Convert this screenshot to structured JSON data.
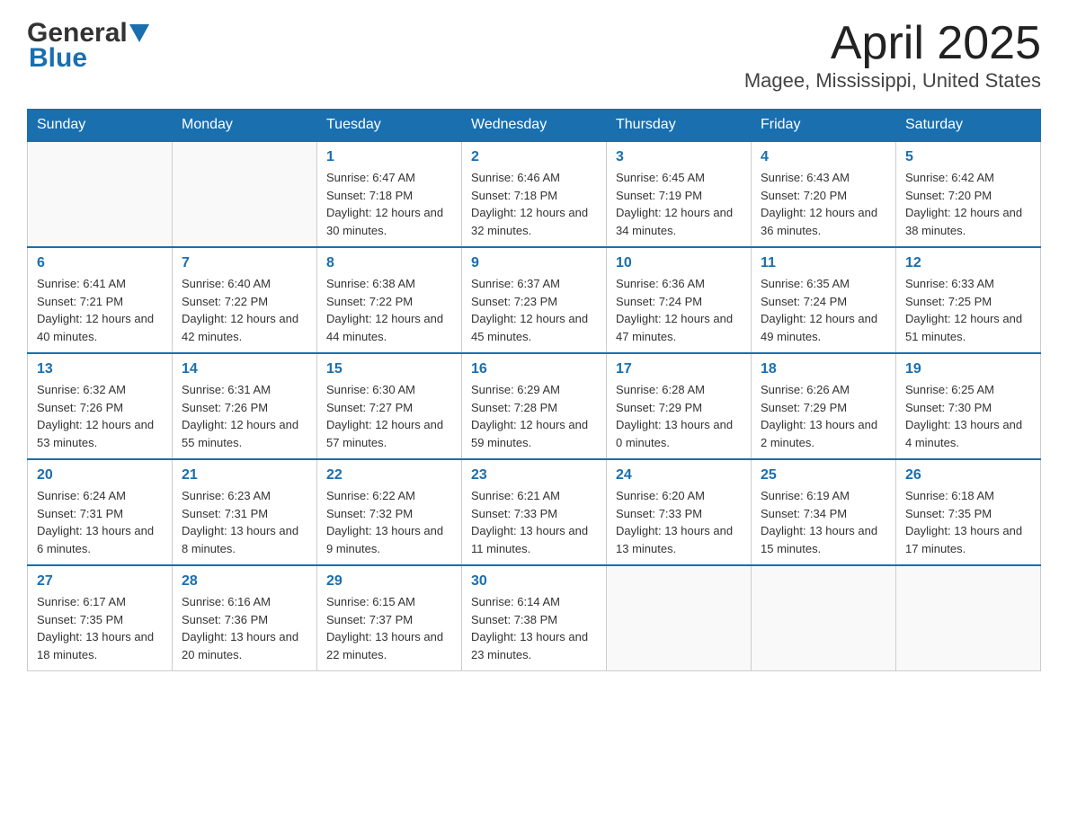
{
  "header": {
    "logo_main": "General",
    "logo_sub": "Blue",
    "title": "April 2025",
    "subtitle": "Magee, Mississippi, United States"
  },
  "days_of_week": [
    "Sunday",
    "Monday",
    "Tuesday",
    "Wednesday",
    "Thursday",
    "Friday",
    "Saturday"
  ],
  "weeks": [
    {
      "days": [
        {
          "number": "",
          "sunrise": "",
          "sunset": "",
          "daylight": "",
          "empty": true
        },
        {
          "number": "",
          "sunrise": "",
          "sunset": "",
          "daylight": "",
          "empty": true
        },
        {
          "number": "1",
          "sunrise": "Sunrise: 6:47 AM",
          "sunset": "Sunset: 7:18 PM",
          "daylight": "Daylight: 12 hours and 30 minutes."
        },
        {
          "number": "2",
          "sunrise": "Sunrise: 6:46 AM",
          "sunset": "Sunset: 7:18 PM",
          "daylight": "Daylight: 12 hours and 32 minutes."
        },
        {
          "number": "3",
          "sunrise": "Sunrise: 6:45 AM",
          "sunset": "Sunset: 7:19 PM",
          "daylight": "Daylight: 12 hours and 34 minutes."
        },
        {
          "number": "4",
          "sunrise": "Sunrise: 6:43 AM",
          "sunset": "Sunset: 7:20 PM",
          "daylight": "Daylight: 12 hours and 36 minutes."
        },
        {
          "number": "5",
          "sunrise": "Sunrise: 6:42 AM",
          "sunset": "Sunset: 7:20 PM",
          "daylight": "Daylight: 12 hours and 38 minutes."
        }
      ]
    },
    {
      "days": [
        {
          "number": "6",
          "sunrise": "Sunrise: 6:41 AM",
          "sunset": "Sunset: 7:21 PM",
          "daylight": "Daylight: 12 hours and 40 minutes."
        },
        {
          "number": "7",
          "sunrise": "Sunrise: 6:40 AM",
          "sunset": "Sunset: 7:22 PM",
          "daylight": "Daylight: 12 hours and 42 minutes."
        },
        {
          "number": "8",
          "sunrise": "Sunrise: 6:38 AM",
          "sunset": "Sunset: 7:22 PM",
          "daylight": "Daylight: 12 hours and 44 minutes."
        },
        {
          "number": "9",
          "sunrise": "Sunrise: 6:37 AM",
          "sunset": "Sunset: 7:23 PM",
          "daylight": "Daylight: 12 hours and 45 minutes."
        },
        {
          "number": "10",
          "sunrise": "Sunrise: 6:36 AM",
          "sunset": "Sunset: 7:24 PM",
          "daylight": "Daylight: 12 hours and 47 minutes."
        },
        {
          "number": "11",
          "sunrise": "Sunrise: 6:35 AM",
          "sunset": "Sunset: 7:24 PM",
          "daylight": "Daylight: 12 hours and 49 minutes."
        },
        {
          "number": "12",
          "sunrise": "Sunrise: 6:33 AM",
          "sunset": "Sunset: 7:25 PM",
          "daylight": "Daylight: 12 hours and 51 minutes."
        }
      ]
    },
    {
      "days": [
        {
          "number": "13",
          "sunrise": "Sunrise: 6:32 AM",
          "sunset": "Sunset: 7:26 PM",
          "daylight": "Daylight: 12 hours and 53 minutes."
        },
        {
          "number": "14",
          "sunrise": "Sunrise: 6:31 AM",
          "sunset": "Sunset: 7:26 PM",
          "daylight": "Daylight: 12 hours and 55 minutes."
        },
        {
          "number": "15",
          "sunrise": "Sunrise: 6:30 AM",
          "sunset": "Sunset: 7:27 PM",
          "daylight": "Daylight: 12 hours and 57 minutes."
        },
        {
          "number": "16",
          "sunrise": "Sunrise: 6:29 AM",
          "sunset": "Sunset: 7:28 PM",
          "daylight": "Daylight: 12 hours and 59 minutes."
        },
        {
          "number": "17",
          "sunrise": "Sunrise: 6:28 AM",
          "sunset": "Sunset: 7:29 PM",
          "daylight": "Daylight: 13 hours and 0 minutes."
        },
        {
          "number": "18",
          "sunrise": "Sunrise: 6:26 AM",
          "sunset": "Sunset: 7:29 PM",
          "daylight": "Daylight: 13 hours and 2 minutes."
        },
        {
          "number": "19",
          "sunrise": "Sunrise: 6:25 AM",
          "sunset": "Sunset: 7:30 PM",
          "daylight": "Daylight: 13 hours and 4 minutes."
        }
      ]
    },
    {
      "days": [
        {
          "number": "20",
          "sunrise": "Sunrise: 6:24 AM",
          "sunset": "Sunset: 7:31 PM",
          "daylight": "Daylight: 13 hours and 6 minutes."
        },
        {
          "number": "21",
          "sunrise": "Sunrise: 6:23 AM",
          "sunset": "Sunset: 7:31 PM",
          "daylight": "Daylight: 13 hours and 8 minutes."
        },
        {
          "number": "22",
          "sunrise": "Sunrise: 6:22 AM",
          "sunset": "Sunset: 7:32 PM",
          "daylight": "Daylight: 13 hours and 9 minutes."
        },
        {
          "number": "23",
          "sunrise": "Sunrise: 6:21 AM",
          "sunset": "Sunset: 7:33 PM",
          "daylight": "Daylight: 13 hours and 11 minutes."
        },
        {
          "number": "24",
          "sunrise": "Sunrise: 6:20 AM",
          "sunset": "Sunset: 7:33 PM",
          "daylight": "Daylight: 13 hours and 13 minutes."
        },
        {
          "number": "25",
          "sunrise": "Sunrise: 6:19 AM",
          "sunset": "Sunset: 7:34 PM",
          "daylight": "Daylight: 13 hours and 15 minutes."
        },
        {
          "number": "26",
          "sunrise": "Sunrise: 6:18 AM",
          "sunset": "Sunset: 7:35 PM",
          "daylight": "Daylight: 13 hours and 17 minutes."
        }
      ]
    },
    {
      "days": [
        {
          "number": "27",
          "sunrise": "Sunrise: 6:17 AM",
          "sunset": "Sunset: 7:35 PM",
          "daylight": "Daylight: 13 hours and 18 minutes."
        },
        {
          "number": "28",
          "sunrise": "Sunrise: 6:16 AM",
          "sunset": "Sunset: 7:36 PM",
          "daylight": "Daylight: 13 hours and 20 minutes."
        },
        {
          "number": "29",
          "sunrise": "Sunrise: 6:15 AM",
          "sunset": "Sunset: 7:37 PM",
          "daylight": "Daylight: 13 hours and 22 minutes."
        },
        {
          "number": "30",
          "sunrise": "Sunrise: 6:14 AM",
          "sunset": "Sunset: 7:38 PM",
          "daylight": "Daylight: 13 hours and 23 minutes."
        },
        {
          "number": "",
          "sunrise": "",
          "sunset": "",
          "daylight": "",
          "empty": true
        },
        {
          "number": "",
          "sunrise": "",
          "sunset": "",
          "daylight": "",
          "empty": true
        },
        {
          "number": "",
          "sunrise": "",
          "sunset": "",
          "daylight": "",
          "empty": true
        }
      ]
    }
  ]
}
